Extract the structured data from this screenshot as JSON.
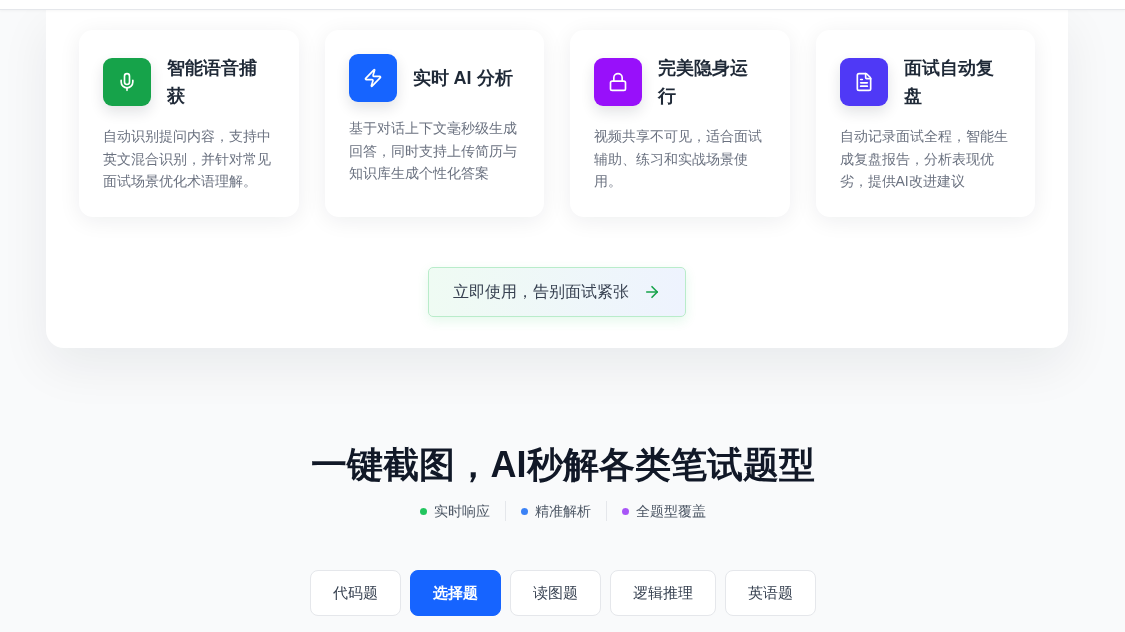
{
  "features": [
    {
      "title": "智能语音捕获",
      "description": "自动识别提问内容，支持中英文混合识别，并针对常见面试场景优化术语理解。",
      "color": "#16a34a"
    },
    {
      "title": "实时 AI 分析",
      "description": "基于对话上下文毫秒级生成回答，同时支持上传简历与知识库生成个性化答案",
      "color": "#1664ff"
    },
    {
      "title": "完美隐身运行",
      "description": "视频共享不可见，适合面试辅助、练习和实战场景使用。",
      "color": "#9810fa"
    },
    {
      "title": "面试自动复盘",
      "description": "自动记录面试全程，智能生成复盘报告，分析表现优劣，提供AI改进建议",
      "color": "#4f39f6"
    }
  ],
  "cta_button": {
    "label": "立即使用，告别面试紧张"
  },
  "section_title": "一键截图，AI秒解各类笔试题型",
  "highlights": [
    {
      "label": "实时响应",
      "color": "#22c55e"
    },
    {
      "label": "精准解析",
      "color": "#3b82f6"
    },
    {
      "label": "全题型覆盖",
      "color": "#a855f7"
    }
  ],
  "question_types": [
    {
      "label": "代码题",
      "selected": false
    },
    {
      "label": "选择题",
      "selected": true
    },
    {
      "label": "读图题",
      "selected": false
    },
    {
      "label": "逻辑推理",
      "selected": false
    },
    {
      "label": "英语题",
      "selected": false
    }
  ]
}
